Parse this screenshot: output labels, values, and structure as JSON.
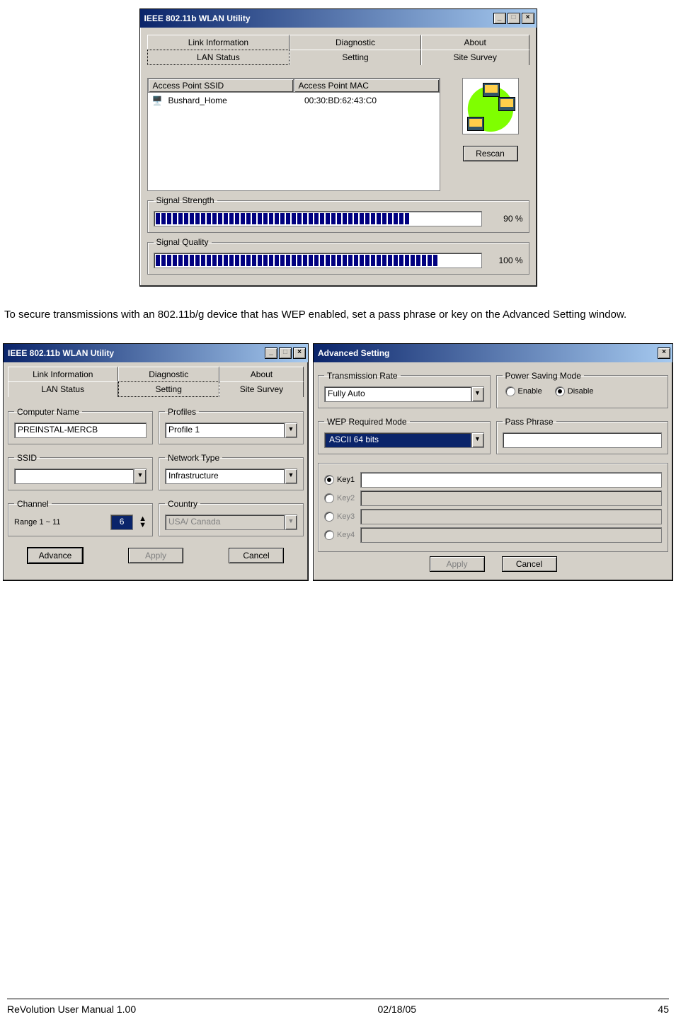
{
  "win1": {
    "title": "IEEE 802.11b WLAN Utility",
    "tabs_top": [
      "Link Information",
      "Diagnostic",
      "About"
    ],
    "tabs_bot": [
      "LAN Status",
      "Setting",
      "Site Survey"
    ],
    "col_ssid": "Access Point SSID",
    "col_mac": "Access Point MAC",
    "row_ssid": "Bushard_Home",
    "row_mac": "00:30:BD:62:43:C0",
    "rescan": "Rescan",
    "sig_strength_label": "Signal Strength",
    "sig_strength_val": "90 %",
    "sig_strength_pct": 90,
    "sig_quality_label": "Signal Quality",
    "sig_quality_val": "100 %",
    "sig_quality_pct": 100
  },
  "para": "To secure transmissions with an 802.11b/g device that has WEP enabled, set a pass phrase or key on the Advanced Setting window.",
  "win2": {
    "title": "IEEE 802.11b WLAN Utility",
    "tabs_top": [
      "Link Information",
      "Diagnostic",
      "About"
    ],
    "tabs_bot": [
      "LAN Status",
      "Setting",
      "Site Survey"
    ],
    "computer_name_label": "Computer Name",
    "computer_name": "PREINSTAL-MERCB",
    "profiles_label": "Profiles",
    "profiles_val": "Profile 1",
    "ssid_label": "SSID",
    "ssid_val": "",
    "network_type_label": "Network Type",
    "network_type_val": "Infrastructure",
    "channel_label": "Channel",
    "channel_range": "Range 1 ~ 11",
    "channel_val": "6",
    "country_label": "Country",
    "country_val": "USA/ Canada",
    "advance": "Advance",
    "apply": "Apply",
    "cancel": "Cancel"
  },
  "win3": {
    "title": "Advanced Setting",
    "tx_rate_label": "Transmission Rate",
    "tx_rate_val": "Fully Auto",
    "psm_label": "Power Saving Mode",
    "psm_enable": "Enable",
    "psm_disable": "Disable",
    "wep_label": "WEP Required Mode",
    "wep_val": "ASCII 64 bits",
    "passphrase_label": "Pass Phrase",
    "key1": "Key1",
    "key2": "Key2",
    "key3": "Key3",
    "key4": "Key4",
    "apply": "Apply",
    "cancel": "Cancel"
  },
  "footer": {
    "left": "ReVolution User Manual 1.00",
    "center": "02/18/05",
    "right": "45"
  }
}
